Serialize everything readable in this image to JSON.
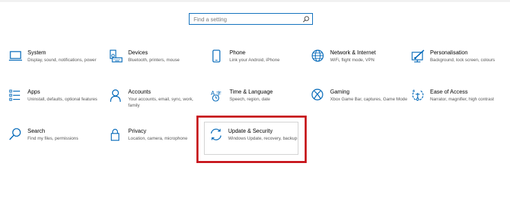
{
  "search": {
    "placeholder": "Find a setting"
  },
  "colors": {
    "accent": "#0067b8",
    "highlight": "#c8161d"
  },
  "tiles": [
    {
      "title": "System",
      "desc": "Display, sound, notifications, power",
      "icon": "laptop-icon"
    },
    {
      "title": "Devices",
      "desc": "Bluetooth, printers, mouse",
      "icon": "keyboard-speaker-icon"
    },
    {
      "title": "Phone",
      "desc": "Link your Android, iPhone",
      "icon": "phone-icon"
    },
    {
      "title": "Network & Internet",
      "desc": "WiFi, flight mode, VPN",
      "icon": "globe-icon"
    },
    {
      "title": "Personalisation",
      "desc": "Background, lock screen, colours",
      "icon": "brush-screen-icon"
    },
    {
      "title": "Apps",
      "desc": "Uninstall, defaults, optional features",
      "icon": "apps-list-icon"
    },
    {
      "title": "Accounts",
      "desc": "Your accounts, email, sync, work, family",
      "icon": "person-icon"
    },
    {
      "title": "Time & Language",
      "desc": "Speech, region, date",
      "icon": "time-language-icon"
    },
    {
      "title": "Gaming",
      "desc": "Xbox Game Bar, captures, Game Mode",
      "icon": "xbox-icon"
    },
    {
      "title": "Ease of Access",
      "desc": "Narrator, magnifier, high contrast",
      "icon": "ease-of-access-icon"
    },
    {
      "title": "Search",
      "desc": "Find my files, permissions",
      "icon": "search-icon"
    },
    {
      "title": "Privacy",
      "desc": "Location, camera, microphone",
      "icon": "lock-icon"
    },
    {
      "title": "Update & Security",
      "desc": "Windows Update, recovery, backup",
      "icon": "sync-arrows-icon"
    }
  ]
}
